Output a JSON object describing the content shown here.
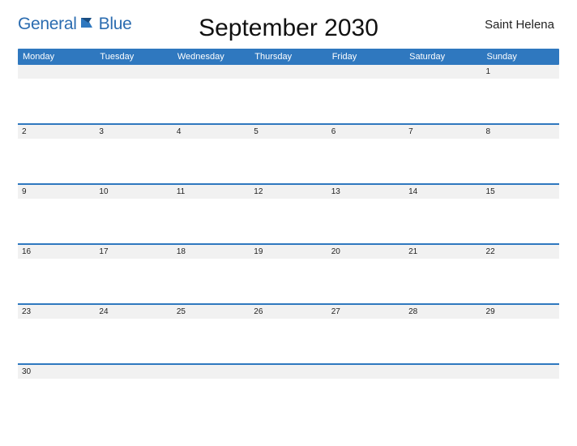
{
  "brand": {
    "part1": "General",
    "part2": "Blue"
  },
  "title": "September 2030",
  "region": "Saint Helena",
  "colors": {
    "accent": "#2f78bf",
    "stripe": "#f1f1f1"
  },
  "dayHeaders": [
    "Monday",
    "Tuesday",
    "Wednesday",
    "Thursday",
    "Friday",
    "Saturday",
    "Sunday"
  ],
  "weeks": [
    [
      "",
      "",
      "",
      "",
      "",
      "",
      "1"
    ],
    [
      "2",
      "3",
      "4",
      "5",
      "6",
      "7",
      "8"
    ],
    [
      "9",
      "10",
      "11",
      "12",
      "13",
      "14",
      "15"
    ],
    [
      "16",
      "17",
      "18",
      "19",
      "20",
      "21",
      "22"
    ],
    [
      "23",
      "24",
      "25",
      "26",
      "27",
      "28",
      "29"
    ],
    [
      "30",
      "",
      "",
      "",
      "",
      "",
      ""
    ]
  ]
}
